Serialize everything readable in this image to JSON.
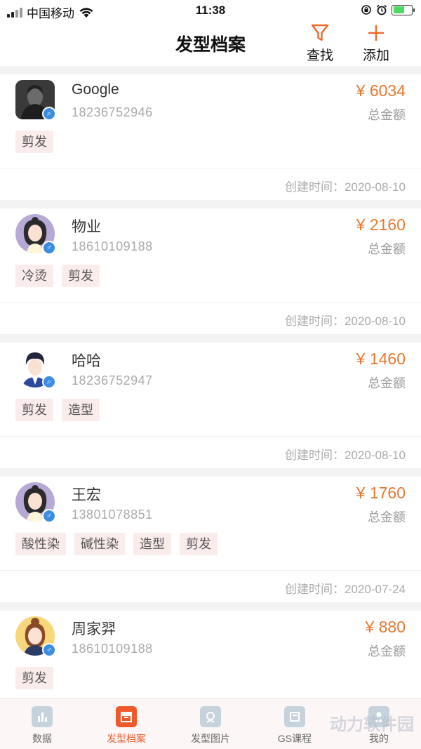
{
  "status_bar": {
    "carrier": "中国移动",
    "time": "11:38"
  },
  "nav": {
    "title": "发型档案",
    "search_label": "查找",
    "add_label": "添加"
  },
  "customers": [
    {
      "name": "Google",
      "phone": "18236752946",
      "amount": "¥ 6034",
      "amount_label": "总金额",
      "tags": [
        "剪发"
      ],
      "created": "创建时间：2020-08-10",
      "avatar": "photo-avatar"
    },
    {
      "name": "物业",
      "phone": "18610109188",
      "amount": "¥ 2160",
      "amount_label": "总金额",
      "tags": [
        "冷烫",
        "剪发"
      ],
      "created": "创建时间：2020-08-10",
      "avatar": "female-avatar"
    },
    {
      "name": "哈哈",
      "phone": "18236752947",
      "amount": "¥ 1460",
      "amount_label": "总金额",
      "tags": [
        "剪发",
        "造型"
      ],
      "created": "创建时间：2020-08-10",
      "avatar": "male-avatar"
    },
    {
      "name": "王宏",
      "phone": "13801078851",
      "amount": "¥ 1760",
      "amount_label": "总金额",
      "tags": [
        "酸性染",
        "碱性染",
        "造型",
        "剪发"
      ],
      "created": "创建时间：2020-07-24",
      "avatar": "female-avatar"
    },
    {
      "name": "周家羿",
      "phone": "18610109188",
      "amount": "¥ 880",
      "amount_label": "总金额",
      "tags": [
        "剪发"
      ],
      "created": "",
      "avatar": "female-bun-avatar"
    }
  ],
  "tabs": [
    {
      "label": "数据",
      "icon": "chart-icon",
      "active": false
    },
    {
      "label": "发型档案",
      "icon": "archive-icon",
      "active": true
    },
    {
      "label": "发型图片",
      "icon": "image-icon",
      "active": false
    },
    {
      "label": "GS课程",
      "icon": "course-icon",
      "active": false
    },
    {
      "label": "我的",
      "icon": "user-icon",
      "active": false
    }
  ],
  "watermark": "动力软件园",
  "colors": {
    "accent": "#ef5a2a",
    "amount": "#e8782f",
    "tag_bg": "#fbecec"
  }
}
